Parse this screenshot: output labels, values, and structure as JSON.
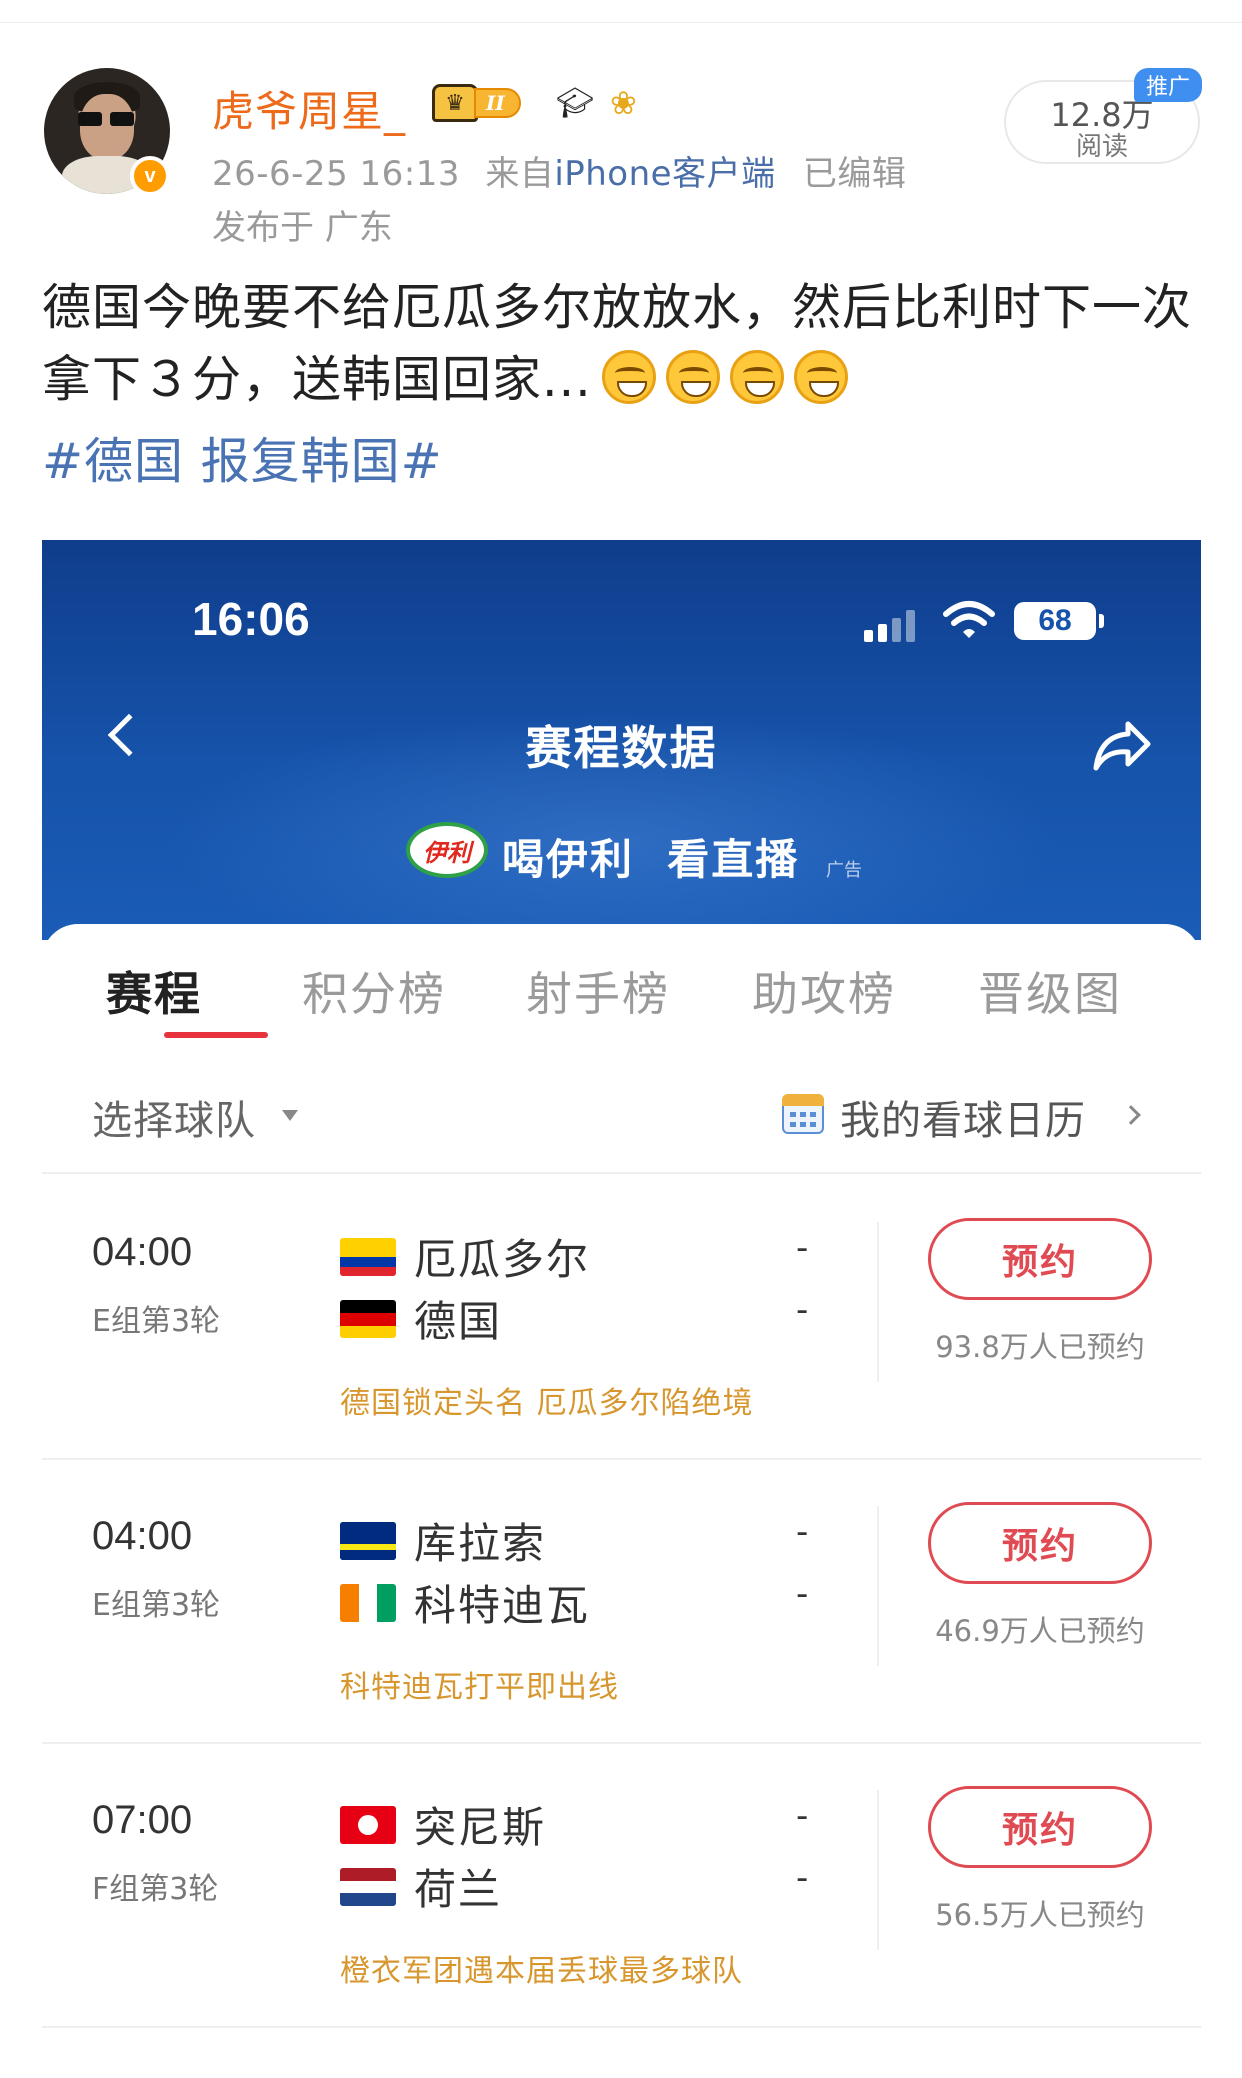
{
  "post": {
    "username": "虎爷周星_",
    "level_badge": "II",
    "timestamp": "26-6-25 16:13",
    "source_prefix": "来自",
    "source": "iPhone客户端",
    "edited": "已编辑",
    "location": "发布于 广东",
    "reads_count": "12.8万",
    "reads_label": "阅读",
    "promo_tag": "推广",
    "text": "德国今晚要不给厄瓜多尔放放水，然后比利时下一次拿下３分，送韩国回家...",
    "hashtag": "#德国 报复韩国#",
    "emoji_icon": "grin-emoji"
  },
  "screenshot": {
    "status_time": "16:06",
    "battery": "68",
    "page_title": "赛程数据",
    "ad_logo": "伊利",
    "ad_text": "喝伊利  看直播",
    "ad_tag": "广告",
    "header_color": "#1653aa",
    "tabs": [
      {
        "label": "赛程",
        "active": true
      },
      {
        "label": "积分榜",
        "active": false
      },
      {
        "label": "射手榜",
        "active": false
      },
      {
        "label": "助攻榜",
        "active": false
      },
      {
        "label": "晋级图",
        "active": false
      }
    ],
    "team_select": "选择球队",
    "calendar_link": "我的看球日历",
    "matches": [
      {
        "time": "04:00",
        "round": "E组第3轮",
        "home": {
          "name": "厄瓜多尔",
          "score": "-",
          "flag": "ecuador-flag"
        },
        "away": {
          "name": "德国",
          "score": "-",
          "flag": "germany-flag"
        },
        "button": "预约",
        "count": "93.8万人已预约",
        "note": "德国锁定头名 厄瓜多尔陷绝境"
      },
      {
        "time": "04:00",
        "round": "E组第3轮",
        "home": {
          "name": "库拉索",
          "score": "-",
          "flag": "curacao-flag"
        },
        "away": {
          "name": "科特迪瓦",
          "score": "-",
          "flag": "ivory-coast-flag"
        },
        "button": "预约",
        "count": "46.9万人已预约",
        "note": "科特迪瓦打平即出线"
      },
      {
        "time": "07:00",
        "round": "F组第3轮",
        "home": {
          "name": "突尼斯",
          "score": "-",
          "flag": "tunisia-flag"
        },
        "away": {
          "name": "荷兰",
          "score": "-",
          "flag": "netherlands-flag"
        },
        "button": "预约",
        "count": "56.5万人已预约",
        "note": "橙衣军团遇本届丢球最多球队"
      }
    ]
  },
  "colors": {
    "username": "#ee6a1b",
    "hashtag": "#4a73b3",
    "accent_red": "#e04a52",
    "note_orange": "#d8962e"
  }
}
